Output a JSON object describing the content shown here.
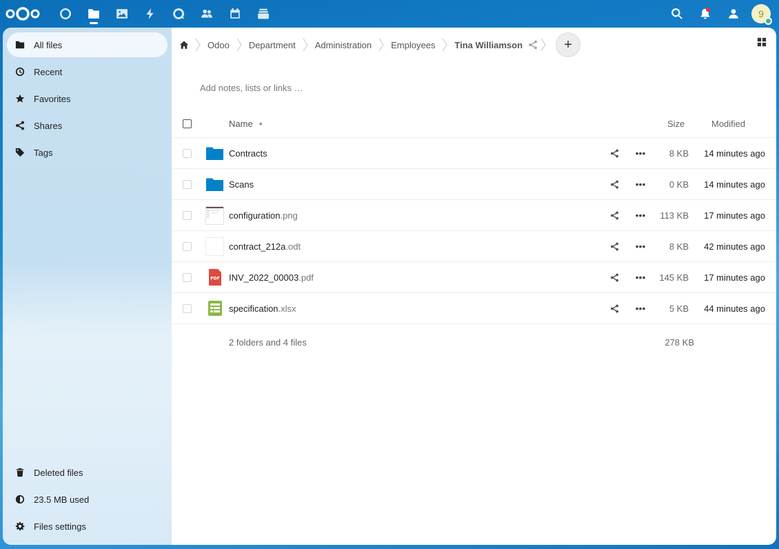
{
  "header": {
    "apps": [
      {
        "name": "dashboard",
        "icon": "dashboard-icon"
      },
      {
        "name": "files",
        "icon": "files-icon"
      },
      {
        "name": "photos",
        "icon": "photos-icon"
      },
      {
        "name": "activity",
        "icon": "activity-icon"
      },
      {
        "name": "talk",
        "icon": "talk-icon"
      },
      {
        "name": "contacts",
        "icon": "contacts-icon"
      },
      {
        "name": "calendar",
        "icon": "calendar-icon"
      },
      {
        "name": "deck",
        "icon": "deck-icon"
      }
    ],
    "avatar_letter": "9"
  },
  "sidebar": {
    "items": [
      {
        "label": "All files",
        "icon": "folder-icon"
      },
      {
        "label": "Recent",
        "icon": "clock-icon"
      },
      {
        "label": "Favorites",
        "icon": "star-icon"
      },
      {
        "label": "Shares",
        "icon": "share-icon"
      },
      {
        "label": "Tags",
        "icon": "tag-icon"
      }
    ],
    "bottom": [
      {
        "label": "Deleted files",
        "icon": "trash-icon"
      },
      {
        "label": "23.5 MB used",
        "icon": "quota-icon"
      },
      {
        "label": "Files settings",
        "icon": "gear-icon"
      }
    ]
  },
  "breadcrumbs": [
    "Odoo",
    "Department",
    "Administration",
    "Employees",
    "Tina Williamson"
  ],
  "add_button": "+",
  "notes_placeholder": "Add notes, lists or links …",
  "table": {
    "headers": {
      "name": "Name",
      "size": "Size",
      "modified": "Modified"
    },
    "rows": [
      {
        "base": "Contracts",
        "ext": "",
        "type": "folder",
        "size": "8 KB",
        "modified": "14 minutes ago"
      },
      {
        "base": "Scans",
        "ext": "",
        "type": "folder",
        "size": "0 KB",
        "modified": "14 minutes ago"
      },
      {
        "base": "configuration",
        "ext": ".png",
        "type": "image",
        "size": "113 KB",
        "modified": "17 minutes ago"
      },
      {
        "base": "contract_212a",
        "ext": ".odt",
        "type": "document",
        "size": "8 KB",
        "modified": "42 minutes ago"
      },
      {
        "base": "INV_2022_00003",
        "ext": ".pdf",
        "type": "pdf",
        "size": "145 KB",
        "modified": "17 minutes ago"
      },
      {
        "base": "specification",
        "ext": ".xlsx",
        "type": "spreadsheet",
        "size": "5 KB",
        "modified": "44 minutes ago"
      }
    ],
    "summary": {
      "text": "2 folders and 4 files",
      "size": "278 KB"
    }
  },
  "icons": {
    "pdf_label": "PDF"
  },
  "colors": {
    "primary": "#0082c9",
    "folder": "#0082c9",
    "pdf": "#dc4b3f",
    "spreadsheet": "#8bb84a"
  }
}
